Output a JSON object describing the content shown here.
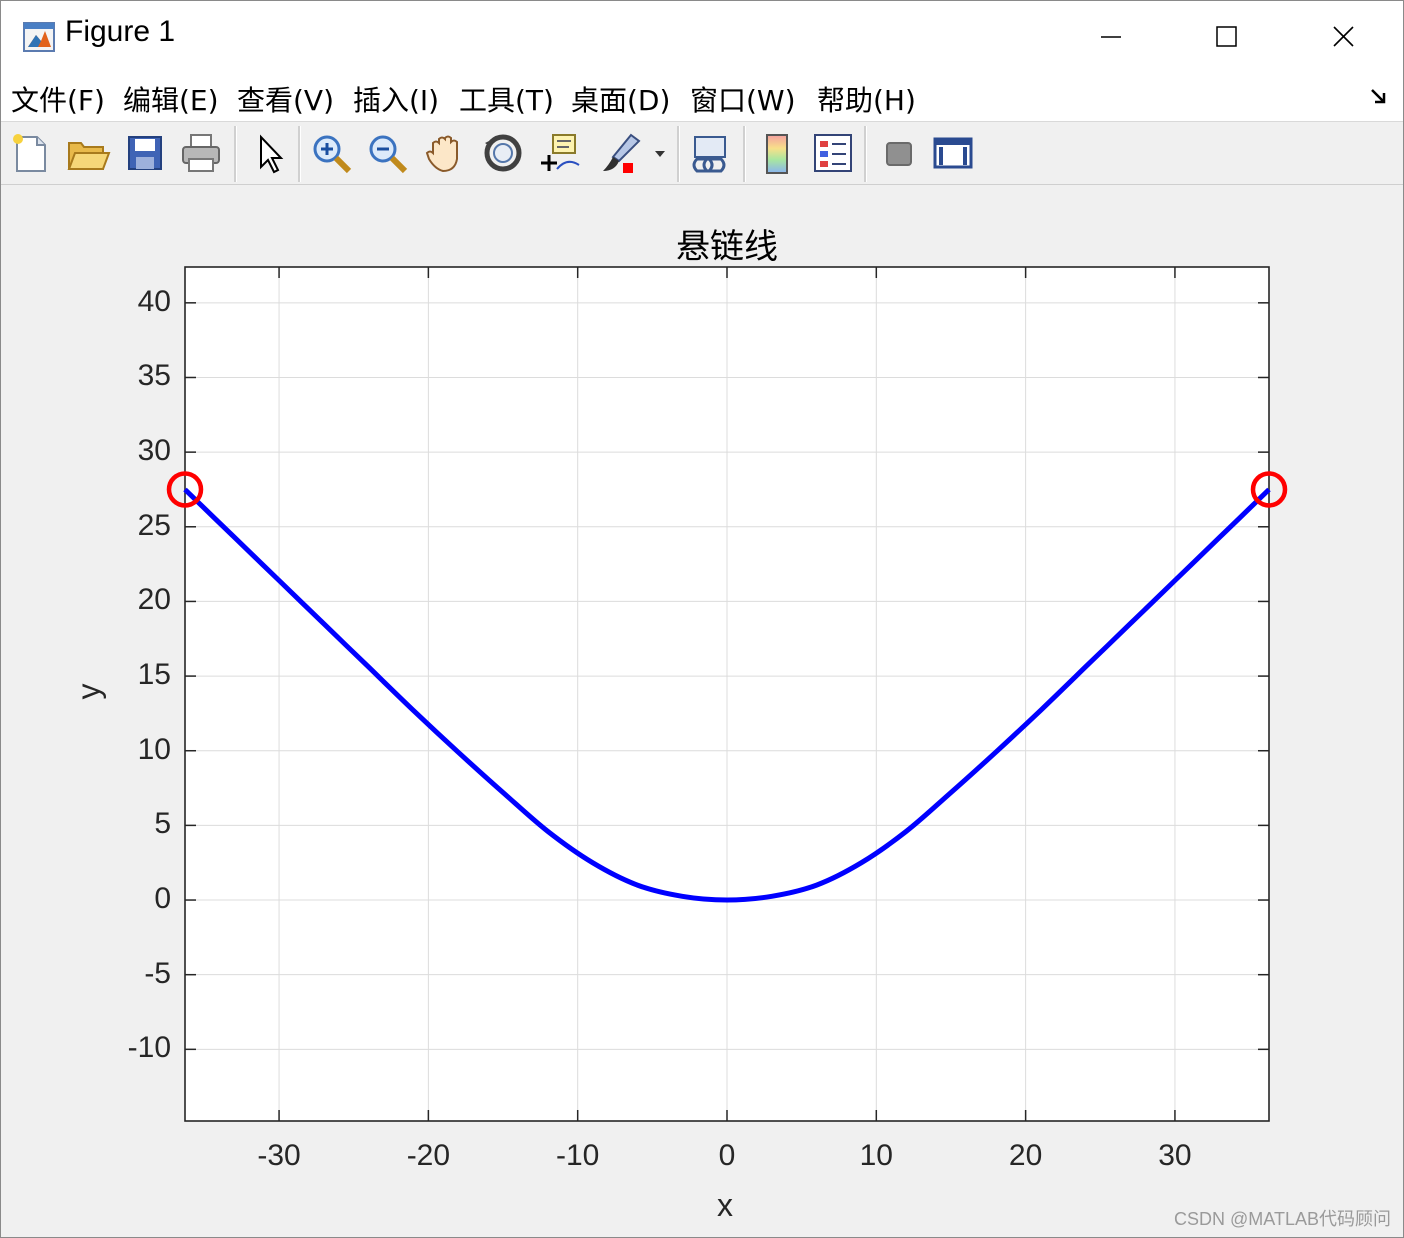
{
  "window": {
    "title": "Figure 1"
  },
  "menu": {
    "items": [
      {
        "label": "文件(F)"
      },
      {
        "label": "编辑(E)"
      },
      {
        "label": "查看(V)"
      },
      {
        "label": "插入(I)"
      },
      {
        "label": "工具(T)"
      },
      {
        "label": "桌面(D)"
      },
      {
        "label": "窗口(W)"
      },
      {
        "label": "帮助(H)"
      }
    ]
  },
  "toolbar": {
    "icons": [
      "new-figure-icon",
      "open-file-icon",
      "save-icon",
      "print-icon",
      "edit-plot-arrow-icon",
      "zoom-in-icon",
      "zoom-out-icon",
      "pan-hand-icon",
      "rotate-3d-icon",
      "data-cursor-icon",
      "brush-icon",
      "link-plot-icon",
      "colorbar-icon",
      "legend-icon",
      "hide-plot-tools-icon",
      "show-plot-tools-icon"
    ]
  },
  "colors": {
    "curve": "#0000ff",
    "markers": "#ff0000",
    "grid": "#dcdcdc",
    "axes_bg": "#ffffff",
    "figure_bg": "#f0f0f0"
  },
  "chart_data": {
    "type": "line",
    "title": "悬链线",
    "xlabel": "x",
    "ylabel": "y",
    "xlim": [
      -36.3,
      36.3
    ],
    "ylim": [
      -14.8,
      42.4
    ],
    "xticks": [
      -30,
      -20,
      -10,
      0,
      10,
      20,
      30
    ],
    "xtick_labels": [
      "-30",
      "-20",
      "-10",
      "0",
      "10",
      "20",
      "30"
    ],
    "yticks": [
      -10,
      -5,
      0,
      5,
      10,
      15,
      20,
      25,
      30,
      35,
      40
    ],
    "ytick_labels": [
      "-10",
      "-5",
      "0",
      "5",
      "10",
      "15",
      "20",
      "25",
      "30",
      "35",
      "40"
    ],
    "grid": true,
    "series": [
      {
        "style": "line",
        "x": [
          -36.3,
          -33,
          -30,
          -27,
          -24,
          -21,
          -18,
          -15,
          -12,
          -9,
          -6,
          -3,
          0,
          3,
          6,
          9,
          12,
          15,
          18,
          21,
          24,
          27,
          30,
          33,
          36.3
        ],
        "y": [
          27.5,
          24.3,
          21.4,
          18.5,
          15.6,
          12.7,
          9.9,
          7.2,
          4.6,
          2.5,
          1.0,
          0.25,
          0.0,
          0.25,
          1.0,
          2.5,
          4.6,
          7.2,
          9.9,
          12.7,
          15.6,
          18.5,
          21.4,
          24.3,
          27.5
        ]
      },
      {
        "style": "markers",
        "marker": "circle",
        "x": [
          -36.3,
          36.3
        ],
        "y": [
          27.5,
          27.5
        ]
      }
    ]
  },
  "watermark": "CSDN @MATLAB代码顾问"
}
